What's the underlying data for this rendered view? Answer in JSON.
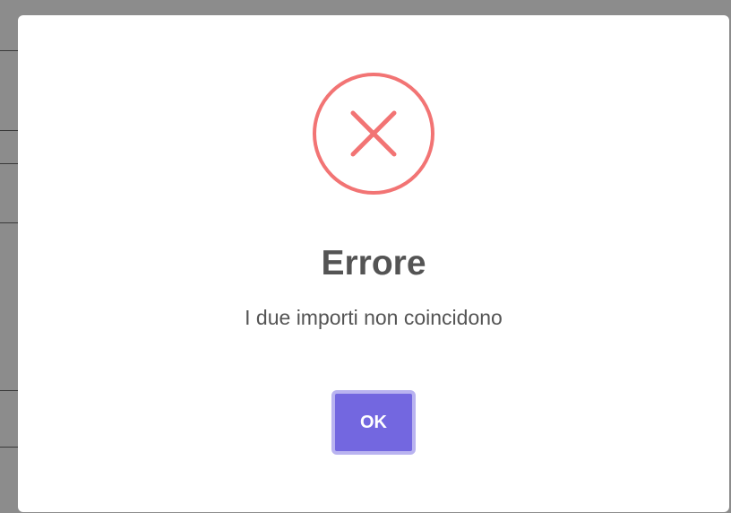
{
  "dialog": {
    "icon": "error-x-icon",
    "title": "Errore",
    "message": "I due importi non coincidono",
    "ok_label": "OK"
  },
  "colors": {
    "icon": "#f27474",
    "button": "#7367e0",
    "text": "#545454"
  }
}
